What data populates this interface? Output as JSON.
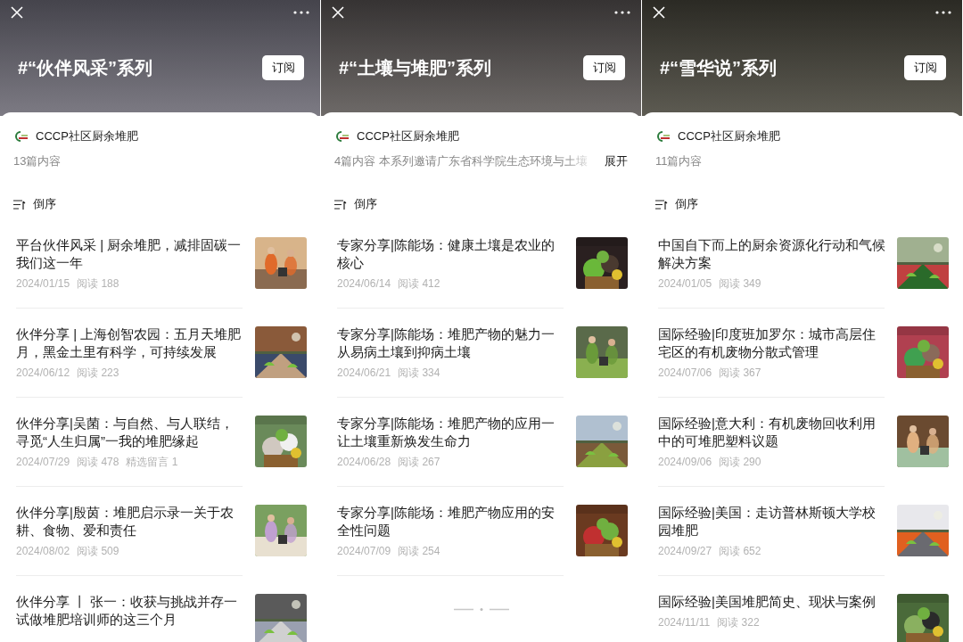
{
  "panels": [
    {
      "title": "#“伙伴风采”系列",
      "subscribe": "订阅",
      "account": "CCCP社区厨余堆肥",
      "count": "13篇内容",
      "sort": "倒序",
      "articles": [
        {
          "title": "平台伙伴风采 | 厨余堆肥，减排固碳一我们这一年",
          "date": "2024/01/15",
          "reads": "阅读 188"
        },
        {
          "title": "伙伴分享 | 上海创智农园：五月天堆肥月，黑金土里有科学，可持续发展",
          "date": "2024/06/12",
          "reads": "阅读 223"
        },
        {
          "title": "伙伴分享|吴菌：与自然、与人联结，寻觅“人生归属”一我的堆肥缘起",
          "date": "2024/07/29",
          "reads": "阅读 478",
          "extra": "精选留言 1"
        },
        {
          "title": "伙伴分享|殷茵：堆肥启示录一关于农耕、食物、爱和责任",
          "date": "2024/08/02",
          "reads": "阅读 509"
        },
        {
          "title": "伙伴分享 丨 张一：收获与挑战并存一试做堆肥培训师的这三个月"
        }
      ]
    },
    {
      "title": "#“土壤与堆肥”系列",
      "subscribe": "订阅",
      "account": "CCCP社区厨余堆肥",
      "count": "4篇内容",
      "description": "本系列邀请广东省科学院生态环境与土壤",
      "expand": "展开",
      "sort": "倒序",
      "loading": true,
      "articles": [
        {
          "title": "专家分享|陈能场：健康土壤是农业的核心",
          "date": "2024/06/14",
          "reads": "阅读 412"
        },
        {
          "title": "专家分享|陈能场：堆肥产物的魅力一从易病土壤到抑病土壤",
          "date": "2024/06/21",
          "reads": "阅读 334"
        },
        {
          "title": "专家分享|陈能场：堆肥产物的应用一让土壤重新焕发生命力",
          "date": "2024/06/28",
          "reads": "阅读 267"
        },
        {
          "title": "专家分享|陈能场：堆肥产物应用的安全性问题",
          "date": "2024/07/09",
          "reads": "阅读 254"
        }
      ]
    },
    {
      "title": "#“雪华说”系列",
      "subscribe": "订阅",
      "account": "CCCP社区厨余堆肥",
      "count": "11篇内容",
      "sort": "倒序",
      "articles": [
        {
          "title": "中国自下而上的厨余资源化行动和气候解决方案",
          "date": "2024/01/05",
          "reads": "阅读 349"
        },
        {
          "title": "国际经验|印度班加罗尔：城市高层住宅区的有机废物分散式管理",
          "date": "2024/07/06",
          "reads": "阅读 367"
        },
        {
          "title": "国际经验|意大利：有机废物回收利用中的可堆肥塑料议题",
          "date": "2024/09/06",
          "reads": "阅读 290"
        },
        {
          "title": "国际经验|美国：走访普林斯顿大学校园堆肥",
          "date": "2024/09/27",
          "reads": "阅读 652"
        },
        {
          "title": "国际经验|美国堆肥简史、现状与案例",
          "date": "2024/11/11",
          "reads": "阅读 322"
        }
      ]
    }
  ]
}
